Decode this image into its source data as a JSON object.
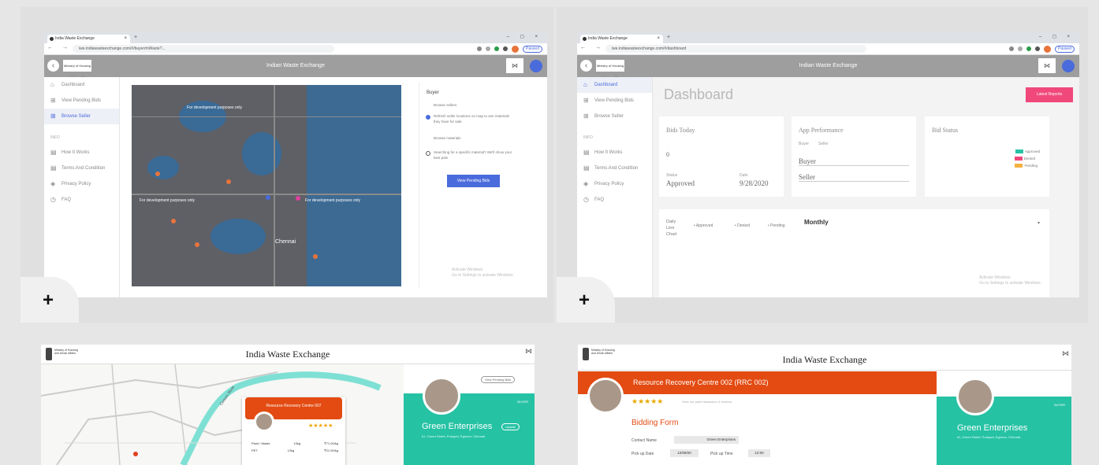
{
  "browser": {
    "tab_title": "India Waste Exchange",
    "tab_close": "×",
    "new_tab": "+",
    "window_controls": "–  ◻  ×",
    "nav_glyphs": "←  →  C",
    "url_map": "iwe.indiawasteexchange.com/#/buyer/mWaste?...",
    "url_dash": "iwe.indiawasteexchange.com/#/dashboard",
    "paused": "Paused"
  },
  "app": {
    "title": "Indian Waste Exchange",
    "logo_text": "Ministry of Housing and Urban Affairs",
    "back_glyph": "‹",
    "mark": "⋈"
  },
  "sidebar": {
    "items": [
      {
        "label": "Dashboard",
        "icon": "⌂"
      },
      {
        "label": "View Pending Bids",
        "icon": "⊞"
      },
      {
        "label": "Browse Seller",
        "icon": "⊞"
      }
    ],
    "info_label": "INFO",
    "info_items": [
      {
        "label": "How It Works",
        "icon": "▤"
      },
      {
        "label": "Terms And Condition",
        "icon": "▤"
      },
      {
        "label": "Privacy Policy",
        "icon": "◈"
      },
      {
        "label": "FAQ",
        "icon": "◷"
      }
    ]
  },
  "buyer_panel": {
    "heading": "Buyer",
    "browse_sellers": "Browse sellers",
    "option1": "Refresh seller locations on map to see materials they have for sale.",
    "browse_materials": "Browse materials",
    "option2": "Searching for a specific material? We'll show your best pals",
    "view_button": "View Pending Bids",
    "activate": "Activate Windows",
    "activate_sub": "Go to Settings to activate Windows."
  },
  "map": {
    "labels": [
      "Chennai",
      "For development purposes only",
      "For development purposes only",
      "For development purposes only"
    ]
  },
  "dashboard": {
    "title": "Dashboard",
    "latest_button": "Latest Reports",
    "bids_today": {
      "title": "Bids Today",
      "count": "0",
      "status_label": "Status",
      "status": "Approved",
      "date_label": "Date",
      "date": "9/28/2020"
    },
    "app_performance": {
      "title": "App Performance",
      "legend": [
        "Buyer",
        "Seller"
      ],
      "rows": [
        "Buyer",
        "Seller"
      ]
    },
    "bid_status": {
      "title": "Bid Status",
      "legend": [
        {
          "label": "Approved",
          "color": "#26c2a4"
        },
        {
          "label": "Denied",
          "color": "#f0487b"
        },
        {
          "label": "Pending",
          "color": "#f5b041"
        }
      ]
    },
    "daily_chart": {
      "title": "Daily Line Chart",
      "legend": [
        "Approved",
        "Denied",
        "Pending"
      ],
      "period": "Monthly",
      "chevron": "▾"
    }
  },
  "bottom_left": {
    "title": "India Waste Exchange",
    "popup_title": "Resource Recovery Centre 007",
    "stars": "★★★★★",
    "table": [
      {
        "name": "Plant / Waste",
        "qty": "10kg",
        "price": "₹71.00/kg"
      },
      {
        "name": "PET",
        "qty": "12kg",
        "price": "₹21.00/kg"
      }
    ],
    "card_name": "Green Enterprises",
    "card_addr": "#1, Green Street, Pudupet, Egmore, Chennai",
    "card_tag": "BUYER",
    "card_pill": "Update",
    "top_pill": "View Pending Bids",
    "road_label": "Cooum River"
  },
  "bottom_right": {
    "title": "India Waste Exchange",
    "banner": "Resource Recovery Centre 002 (RRC 002)",
    "stars": "★★★★★",
    "rating_note": "View our past transaction & reviews",
    "form_title": "Bidding Form",
    "contact_label": "Contact Name",
    "contact_value": "Green Enterprises",
    "pickup_date_label": "Pick up Date",
    "pickup_date": "12/08/20",
    "pickup_time_label": "Pick up Time",
    "pickup_time": "12:00",
    "card_name": "Green Enterprises",
    "card_addr": "#1, Green Street, Pudupet, Egmore, Chennai",
    "card_tag": "BUYER"
  },
  "plus": "+"
}
